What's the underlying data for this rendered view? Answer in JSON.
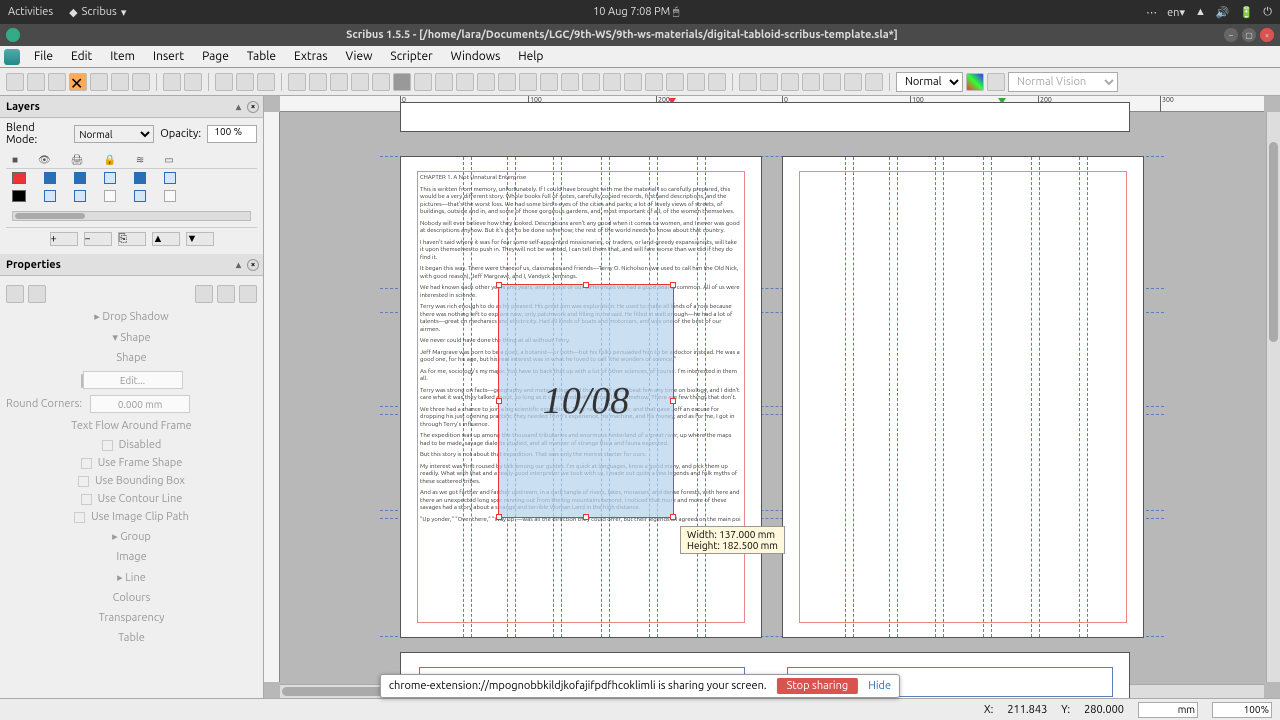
{
  "gnome": {
    "activities": "Activities",
    "app": "Scribus",
    "clock": "10 Aug  7:08 PM",
    "lang": "en"
  },
  "title": "Scribus 1.5.5 - [/home/lara/Documents/LGC/9th-WS/9th-ws-materials/digital-tabloid-scribus-template.sla*]",
  "menu": [
    "File",
    "Edit",
    "Item",
    "Insert",
    "Page",
    "Table",
    "Extras",
    "View",
    "Scripter",
    "Windows",
    "Help"
  ],
  "toolbar": {
    "preview_mode": "Normal",
    "vision_mode": "Normal Vision"
  },
  "layers": {
    "title": "Layers",
    "blend_label": "Blend Mode:",
    "blend_value": "Normal",
    "opacity_label": "Opacity:",
    "opacity_value": "100 %"
  },
  "props": {
    "title": "Properties",
    "drop_shadow": "Drop Shadow",
    "shape": "Shape",
    "shape2": "Shape",
    "edit": "Edit...",
    "round_corners": "Round Corners:",
    "round_value": "0.000 mm",
    "text_flow": "Text Flow Around Frame",
    "disabled": "Disabled",
    "use_frame": "Use Frame Shape",
    "use_bbox": "Use Bounding Box",
    "use_contour": "Use Contour Line",
    "use_clip": "Use Image Clip Path",
    "group": "Group",
    "image": "Image",
    "line": "Line",
    "colours": "Colours",
    "transparency": "Transparency",
    "table": "Table"
  },
  "selection": {
    "stamp": "10/08",
    "tooltip_w": "Width: 137.000 mm",
    "tooltip_h": "Height: 182.500 mm"
  },
  "body_text": {
    "ch": "CHAPTER 1. A Not Unnatural Enterprise",
    "p1": "This is written from memory, unfortunately. If I could have brought with me the material I so carefully prepared, this would be a very different story. Whole books full of notes, carefully copied records, firsthand descriptions, and the pictures—that's the worst loss. We had some bird's-eyes of the cities and parks; a lot of lovely views of streets, of buildings, outside and in, and some of those gorgeous gardens, and, most important of all, of the women themselves.",
    "p2": "Nobody will ever believe how they looked. Descriptions aren't any good when it comes to women, and I never was good at descriptions anyhow. But it's got to be done somehow; the rest of the world needs to know about that country.",
    "p3": "I haven't said where it was for fear some self-appointed missionaries, or traders, or land-greedy expansionists, will take it upon themselves to push in. They will not be wanted, I can tell them that, and will fare worse than we did if they do find it.",
    "p4": "It began this way. There were three of us, classmates and friends—Terry O. Nicholson (we used to call him the Old Nick, with good reason), Jeff Margrave, and I, Vandyck Jennings.",
    "p5": "We had known each other years and years, and in spite of our differences we had a good deal in common. All of us were interested in science.",
    "p6": "Terry was rich enough to do as he pleased. His great aim was exploration. He used to make all kinds of a row because there was nothing left to explore now, only patchwork and filling in, he said. He filled in well enough—he had a lot of talents—great on mechanics and electricity. Had all kinds of boats and motorcars, and was one of the best of our airmen.",
    "p7": "We never could have done the thing at all without Terry.",
    "p8": "Jeff Margrave was born to be a poet, a botanist—or both—but his folks persuaded him to be a doctor instead. He was a good one, for his age, but his real interest was in what he loved to call \"the wonders of science.\"",
    "p9": "As for me, sociology's my major. You have to back that up with a lot of other sciences, of course. I'm interested in them all.",
    "p10": "Terry was strong on facts—geography and meteorology and those; Jeff could beat him any time on biology, and I didn't care what it was they talked about, so long as it connected with human life, somehow. There are few things that don't.",
    "p11": "We three had a chance to join a big scientific expedition. They needed a doctor, and that gave Jeff an excuse for dropping his just opening practice; they needed Terry's experience, his machine, and his money; and as for me, I got in through Terry's influence.",
    "p12": "The expedition was up among the thousand tributaries and enormous hinterland of a great river, up where the maps had to be made, savage dialects studied, and all manner of strange flora and fauna expected.",
    "p13": "But this story is not about that expedition. That was only the merest starter for ours.",
    "p14": "My interest was first roused by talk among our guides. I'm quick at languages, know a good many, and pick them up readily. What with that and a really good interpreter we took with us, I made out quite a few legends and folk myths of these scattered tribes.",
    "p15": "And as we got farther and farther upstream, in a dark tangle of rivers, lakes, morasses, and dense forests, with here and there an unexpected long spur running out from the big mountains beyond, I noticed that more and more of these savages had a story about a strange and terrible Woman Land in the high distance.",
    "p16": "\"Up yonder,\" \"Over there,\" \"Way up\"—was all the direction they could offer, but their legends all agreed on the main poi"
  },
  "status": {
    "x_label": "X:",
    "x": "211.843",
    "y_label": "Y:",
    "y": "280.000",
    "unit": "mm",
    "zoom": "100%"
  },
  "share": {
    "msg": "chrome-extension://mpognobbkildjkofajifpdfhcoklimli is sharing your screen.",
    "stop": "Stop sharing",
    "hide": "Hide"
  }
}
